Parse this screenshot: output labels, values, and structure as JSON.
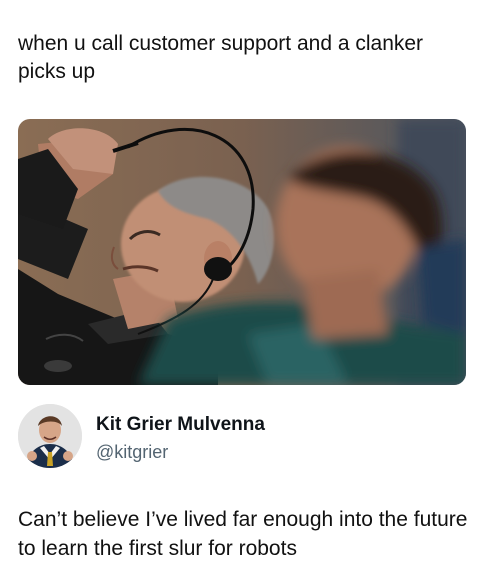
{
  "post": {
    "caption": "when u call customer support and a clanker picks up"
  },
  "quoted_tweet": {
    "display_name": "Kit Grier Mulvenna",
    "handle": "@kitgrier",
    "text": "Can’t believe I’ve lived far enough into the future to learn the first slur for robots"
  }
}
